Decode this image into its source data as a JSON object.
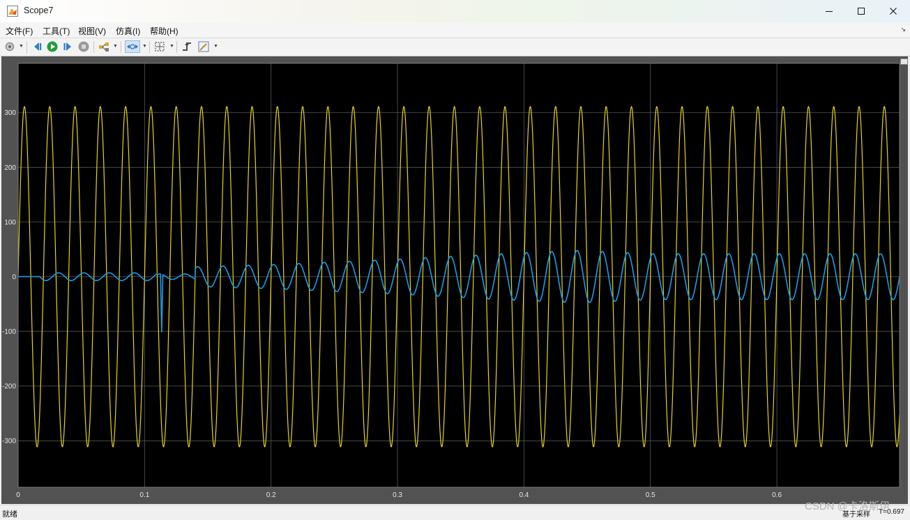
{
  "window": {
    "title": "Scope7",
    "controls": [
      "minimize-icon",
      "maximize-icon",
      "close-icon"
    ]
  },
  "menu": {
    "items": [
      "文件(F)",
      "工具(T)",
      "视图(V)",
      "仿真(I)",
      "帮助(H)"
    ]
  },
  "toolbar": {
    "buttons": [
      {
        "name": "settings",
        "icon": "gear-icon",
        "dropdown": true
      },
      {
        "name": "step-back",
        "icon": "step-back-icon"
      },
      {
        "name": "run",
        "icon": "play-icon"
      },
      {
        "name": "step-forward",
        "icon": "step-forward-icon"
      },
      {
        "name": "stop",
        "icon": "stop-icon"
      },
      {
        "name": "highlight-signal",
        "icon": "signal-highlight-icon",
        "dropdown": true
      },
      {
        "name": "zoom",
        "icon": "zoom-xy-icon",
        "dropdown": true,
        "active": true
      },
      {
        "name": "autoscale",
        "icon": "autoscale-icon",
        "dropdown": true
      },
      {
        "name": "triggers",
        "icon": "trigger-icon"
      },
      {
        "name": "cursor-measurements",
        "icon": "measure-icon",
        "dropdown": true
      }
    ]
  },
  "status": {
    "left": "就绪",
    "right": "基于采样",
    "time": "T=0.697"
  },
  "watermark": "CSDN @卡洛斯伊",
  "colors": {
    "plot_background": "#000000",
    "figure_background": "#525252",
    "grid": "#595959",
    "series_voltage": "#e6d51e",
    "series_current": "#1e9be8"
  },
  "chart_data": {
    "type": "line",
    "xlim": [
      0,
      0.697
    ],
    "ylim": [
      -385,
      390
    ],
    "xticks": [
      0,
      0.1,
      0.2,
      0.3,
      0.4,
      0.5,
      0.6
    ],
    "xtick_labels": [
      "0",
      "0.1",
      "0.2",
      "0.3",
      "0.4",
      "0.5",
      "0.6"
    ],
    "yticks": [
      -300,
      -200,
      -100,
      0,
      100,
      200,
      300
    ],
    "ytick_labels": [
      "-300",
      "-200",
      "-100",
      "0",
      "100",
      "200",
      "300"
    ],
    "grid": true,
    "series": [
      {
        "key": "voltage",
        "shape": "sine",
        "amplitude": 311,
        "frequency_hz": 50,
        "phase_start": "rising-from-zero",
        "t_start": 0,
        "t_end": 0.697
      },
      {
        "key": "current",
        "shape": "sine-with-transient",
        "frequency_hz": 50,
        "segments": [
          {
            "t": 0,
            "value": 0,
            "note": "flat at zero until 0.017"
          },
          {
            "t": 0.017,
            "amplitude": 7
          },
          {
            "t": 0.11,
            "amplitude": 5
          }
        ],
        "spike": {
          "t": 0.1135,
          "value": -102
        },
        "envelope": [
          {
            "t": 0.14,
            "amplitude": 18
          },
          {
            "t": 0.2,
            "amplitude": 22
          },
          {
            "t": 0.3,
            "amplitude": 32
          },
          {
            "t": 0.4,
            "amplitude": 44
          },
          {
            "t": 0.445,
            "amplitude": 48
          },
          {
            "t": 0.5,
            "amplitude": 42
          },
          {
            "t": 0.697,
            "amplitude": 42
          }
        ]
      }
    ]
  }
}
